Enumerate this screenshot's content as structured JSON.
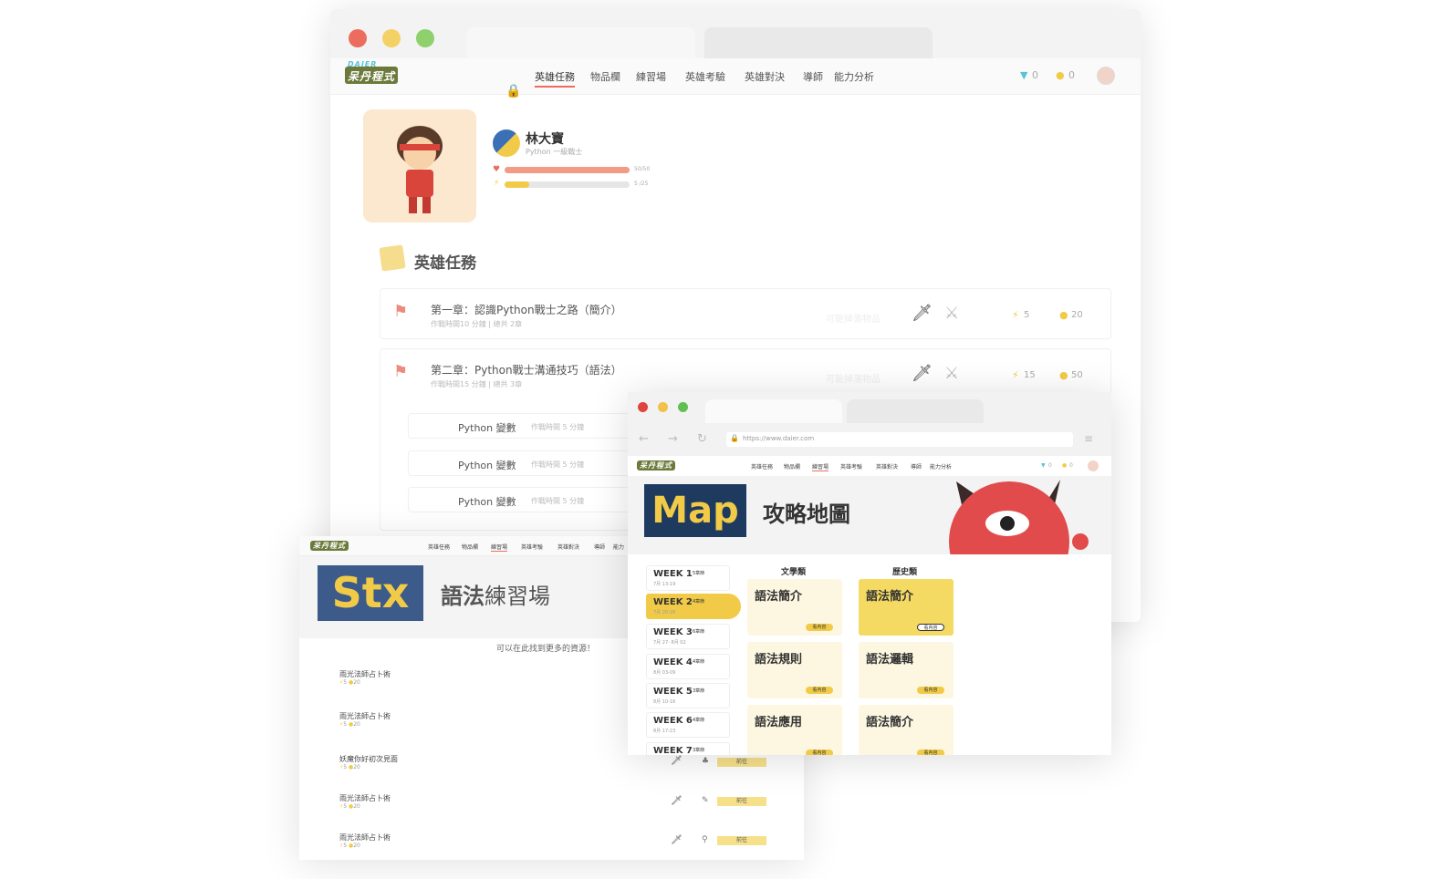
{
  "back_window": {
    "nav": {
      "logo_top": "DAIER",
      "logo_main": "呆丹程式",
      "items": [
        "英雄任務",
        "物品欄",
        "練習場",
        "英雄考驗",
        "英雄對決",
        "導師",
        "能力分析"
      ],
      "gems": "0",
      "coins": "0"
    },
    "profile": {
      "name": "林大寶",
      "rank": "Python 一級戰士",
      "hp_text": "50/50",
      "hp_fraction": 1.0,
      "energy_text": "5 /25",
      "energy_fraction": 0.2
    },
    "section_title": "英雄任務",
    "chapters": [
      {
        "title": "第一章：認識Python戰士之路（簡介）",
        "meta": "作戰時間10 分鐘 | 總共 2章",
        "items_hint": "可能掉落物品",
        "energy": "5",
        "coins": "20"
      },
      {
        "title": "第二章：Python戰士溝通技巧（語法）",
        "meta": "作戰時間15 分鐘 | 總共 3章",
        "items_hint": "可能掉落物品",
        "energy": "15",
        "coins": "50"
      }
    ],
    "sub_lessons": [
      {
        "title": "Python 變數",
        "meta": "作戰時間 5 分鐘"
      },
      {
        "title": "Python 變數",
        "meta": "作戰時間 5 分鐘"
      },
      {
        "title": "Python 變數",
        "meta": "作戰時間 5 分鐘"
      }
    ]
  },
  "stx_window": {
    "nav": [
      "英雄任務",
      "物品欄",
      "練習場",
      "英雄考驗",
      "英雄對決",
      "導師",
      "能力"
    ],
    "badge": "Stx",
    "title_bold": "語法",
    "title_rest": "練習場",
    "subtitle": "可以在此找到更多的資源！",
    "rows": [
      {
        "title": "雨光法師占卜術",
        "energy": "5",
        "coins": "20"
      },
      {
        "title": "雨光法師占卜術",
        "energy": "5",
        "coins": "20"
      },
      {
        "title": "妖魔你好初次見面",
        "energy": "5",
        "coins": "20"
      },
      {
        "title": "雨光法師占卜術",
        "energy": "5",
        "coins": "20"
      },
      {
        "title": "雨光法師占卜術",
        "energy": "5",
        "coins": "20"
      }
    ],
    "go_label": "前往"
  },
  "map_window": {
    "url": "https://www.daier.com",
    "nav": [
      "英雄任務",
      "物品欄",
      "練習場",
      "英雄考驗",
      "英雄對決",
      "導師",
      "能力分析"
    ],
    "gems": "0",
    "coins": "0",
    "badge": "Map",
    "title": "攻略地圖",
    "weeks": [
      {
        "label": "WEEK 1",
        "date": "7月 13-19",
        "lessons": "5章節"
      },
      {
        "label": "WEEK 2",
        "date": "7月 20-26",
        "lessons": "4章節"
      },
      {
        "label": "WEEK 3",
        "date": "7月 27- 8月 02",
        "lessons": "6章節"
      },
      {
        "label": "WEEK 4",
        "date": "8月 03-09",
        "lessons": "4章節"
      },
      {
        "label": "WEEK 5",
        "date": "8月 10-16",
        "lessons": "3章節"
      },
      {
        "label": "WEEK 6",
        "date": "8月 17-23",
        "lessons": "4章節"
      },
      {
        "label": "WEEK 7",
        "date": "",
        "lessons": "3章節"
      }
    ],
    "columns": [
      {
        "heading": "文學類",
        "cards": [
          "語法簡介",
          "語法規則",
          "語法應用"
        ]
      },
      {
        "heading": "歷史類",
        "cards": [
          "語法簡介",
          "語法邏輯",
          "語法簡介"
        ]
      }
    ],
    "card_button": "看內容",
    "accent": "#f1cb47",
    "badge_bg": "#1f3a5f"
  }
}
